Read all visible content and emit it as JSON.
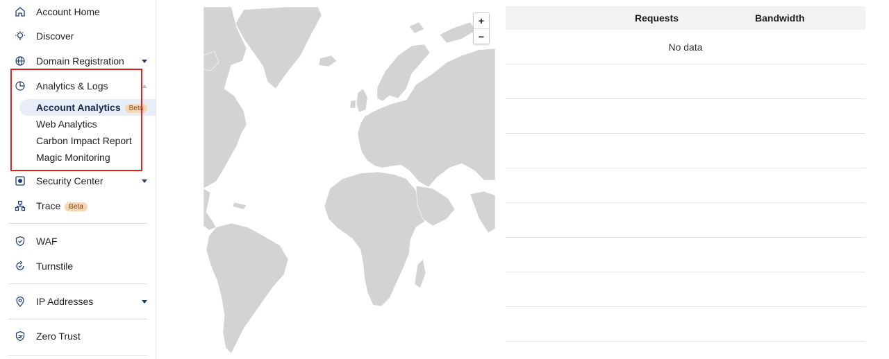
{
  "sidebar": {
    "items": [
      {
        "label": "Account Home",
        "icon": "home-icon"
      },
      {
        "label": "Discover",
        "icon": "lightbulb-icon"
      },
      {
        "label": "Domain Registration",
        "icon": "globe-icon"
      },
      {
        "label": "Analytics & Logs",
        "icon": "chart-pie-icon"
      },
      {
        "label": "Security Center",
        "icon": "shield-box-icon"
      },
      {
        "label": "Trace",
        "icon": "trace-icon",
        "badge": "Beta"
      },
      {
        "label": "WAF",
        "icon": "waf-shield-icon"
      },
      {
        "label": "Turnstile",
        "icon": "turnstile-icon"
      },
      {
        "label": "IP Addresses",
        "icon": "location-pin-icon"
      },
      {
        "label": "Zero Trust",
        "icon": "zero-trust-icon"
      }
    ],
    "analytics_sub": [
      {
        "label": "Account Analytics",
        "badge": "Beta",
        "active": true
      },
      {
        "label": "Web Analytics"
      },
      {
        "label": "Carbon Impact Report"
      },
      {
        "label": "Magic Monitoring"
      }
    ]
  },
  "map": {
    "zoom_in": "+",
    "zoom_out": "−"
  },
  "table": {
    "columns": [
      "Requests",
      "Bandwidth"
    ],
    "empty_text": "No data"
  },
  "colors": {
    "accent": "#1d3b74",
    "highlight_box": "#e02020",
    "land": "#d3d3d3",
    "beta_badge": "#f7d6b2"
  }
}
